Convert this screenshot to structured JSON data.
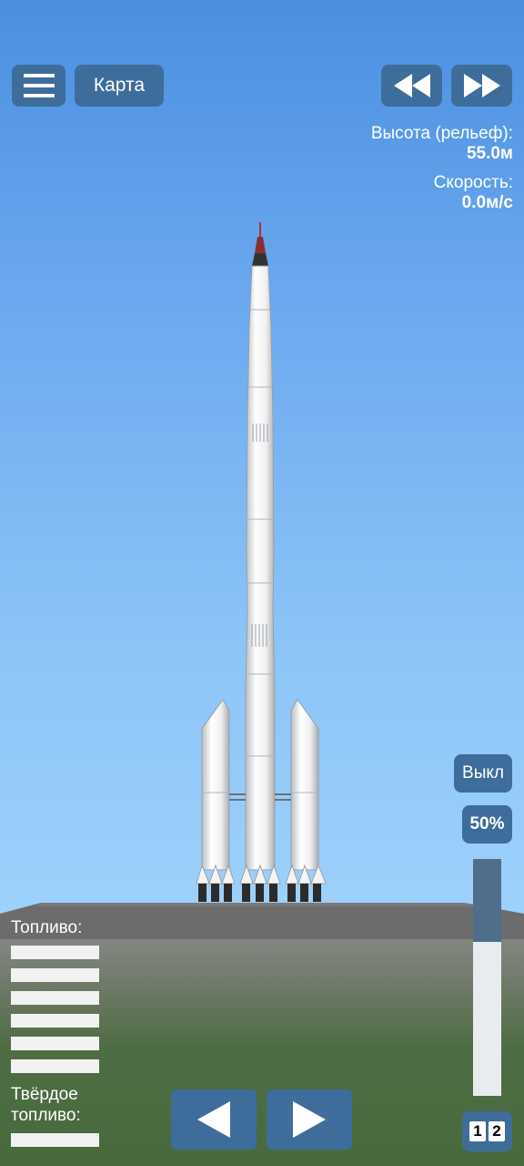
{
  "toolbar": {
    "menu_icon": "hamburger-menu-icon",
    "map_label": "Карта",
    "rewind_icon": "rewind-icon",
    "fast_forward_icon": "fast-forward-icon"
  },
  "telemetry": {
    "altitude_label": "Высота (рельеф):",
    "altitude_value": "55.0м",
    "velocity_label": "Скорость:",
    "velocity_value": "0.0м/с"
  },
  "controls": {
    "engine_toggle_label": "Выкл",
    "throttle_label": "50%",
    "throttle_fraction": 0.5,
    "stage_left_icon": "arrow-left-icon",
    "stage_right_icon": "arrow-right-icon",
    "timewarp_digits": [
      "1",
      "2"
    ]
  },
  "fuel": {
    "liquid_label": "Топливо:",
    "liquid_tank_count": 6,
    "solid_label": "Твёрдое топливо:",
    "solid_tank_count": 1
  },
  "colors": {
    "button_bg": "#3e6d9c",
    "sky_top": "#4a8fe0",
    "sky_bottom": "#a6d6fb",
    "ground_green": "#4a6b3e",
    "launchpad_gray": "#6e6e6e"
  }
}
